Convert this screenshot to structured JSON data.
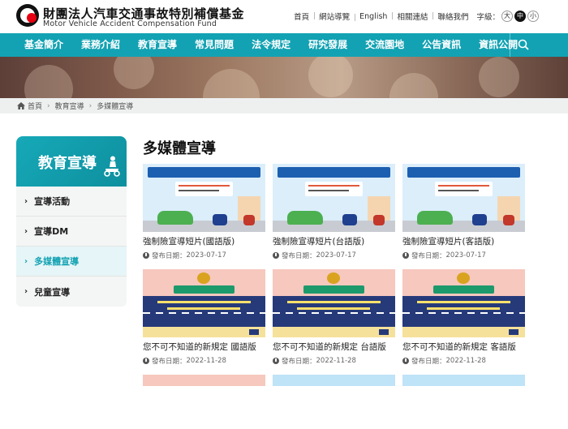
{
  "header": {
    "brand_zh": "財團法人汽車交通事故特別補償基金",
    "brand_en": "Motor Vehicle Accident Compensation Fund",
    "top_links": [
      "首頁",
      "網站導覽",
      "English",
      "相關連結",
      "聯絡我們"
    ],
    "font_size_label": "字級：",
    "font_sizes": [
      "大",
      "中",
      "小"
    ],
    "font_size_selected": "中"
  },
  "nav": {
    "items": [
      "基金簡介",
      "業務介紹",
      "教育宣導",
      "常見問題",
      "法令規定",
      "研究發展",
      "交流園地",
      "公告資訊",
      "資訊公開"
    ],
    "search_icon": "search-icon"
  },
  "breadcrumb": {
    "items": [
      "首頁",
      "教育宣導",
      "多媒體宣導"
    ]
  },
  "sidebar": {
    "title": "教育宣導",
    "icon": "scooter-rider-icon",
    "items": [
      "宣導活動",
      "宣導DM",
      "多媒體宣導",
      "兒童宣導"
    ],
    "active_index": 2
  },
  "main": {
    "title": "多媒體宣導",
    "date_prefix": "發布日期：",
    "cards": [
      {
        "title": "強制險宣導短片(國語版)",
        "date": "2023-07-17"
      },
      {
        "title": "強制險宣導短片(台語版)",
        "date": "2023-07-17"
      },
      {
        "title": "強制險宣導短片(客語版)",
        "date": "2023-07-17"
      },
      {
        "title": "您不可不知道的新規定 國語版",
        "date": "2022-11-28"
      },
      {
        "title": "您不可不知道的新規定 台語版",
        "date": "2022-11-28"
      },
      {
        "title": "您不可不知道的新規定 客語版",
        "date": "2022-11-28"
      }
    ]
  },
  "colors": {
    "accent": "#12a2b3",
    "nav_bg": "#12a2b3",
    "breadcrumb_bg": "#eef0f0",
    "sidebar_item_bg": "#f4f5f5"
  }
}
